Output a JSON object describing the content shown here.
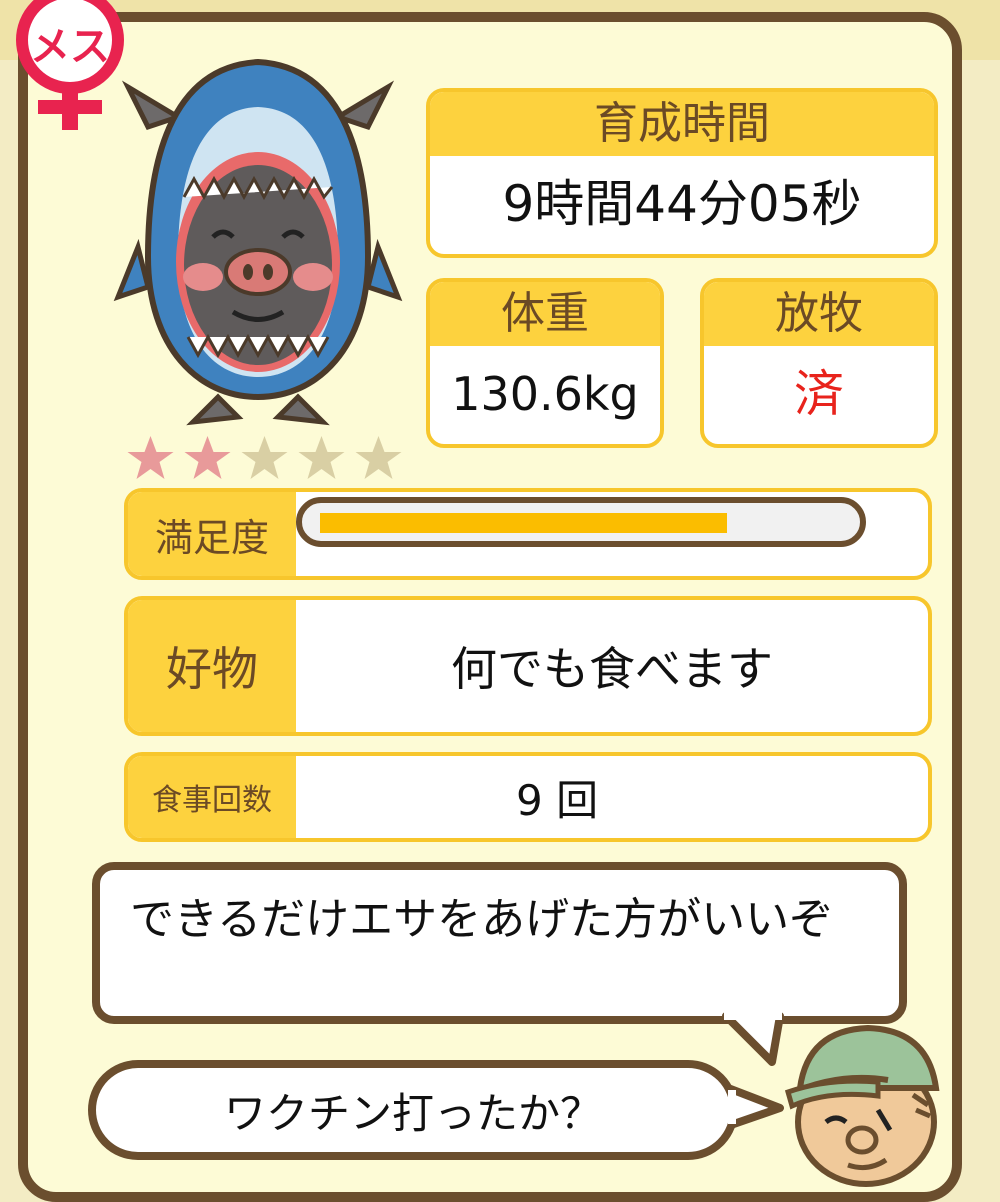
{
  "gender_label": "メス",
  "stars": {
    "rating": 2,
    "max": 5,
    "filled_color": "#e89a9a",
    "empty_color": "#d9cfa4"
  },
  "growth_time": {
    "label": "育成時間",
    "value": "9時間44分05秒"
  },
  "weight": {
    "label": "体重",
    "value": "130.6kg"
  },
  "grazing": {
    "label": "放牧",
    "value": "済",
    "value_color": "#e8231c"
  },
  "satisfaction": {
    "label": "満足度",
    "level": 0.78,
    "fill_color": "#fbbd00"
  },
  "favorite_food": {
    "label": "好物",
    "value": "何でも食べます"
  },
  "meal_count": {
    "label": "食事回数",
    "value": "9 回"
  },
  "dialogue": {
    "advice": "できるだけエサをあげた方がいいぞ",
    "question": "ワクチン打ったか？"
  },
  "colors": {
    "frame": "#6b4e2e",
    "accent": "#fdd23e",
    "panel": "#fdfbd6"
  }
}
